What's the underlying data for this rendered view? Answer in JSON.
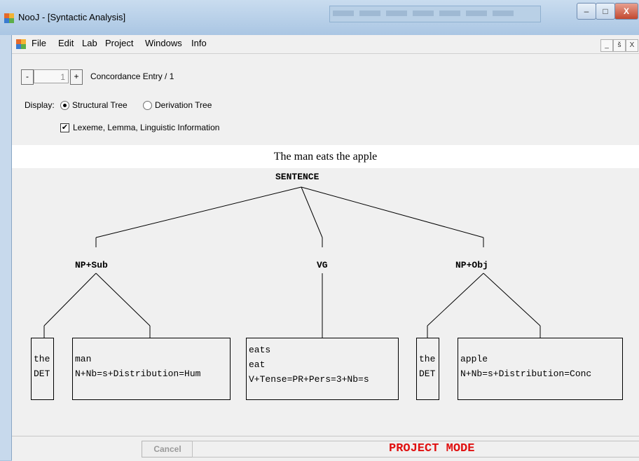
{
  "window": {
    "title": "NooJ - [Syntactic Analysis]",
    "min_label": "–",
    "max_label": "□",
    "close_label": "X"
  },
  "menu": {
    "items": [
      "File",
      "Edit",
      "Lab",
      "Project",
      "Windows",
      "Info"
    ],
    "mdi_min": "_",
    "mdi_restore": "š",
    "mdi_close": "X"
  },
  "controls": {
    "prev_label": "-",
    "entry_value": "1",
    "next_label": "+",
    "concordance_label": "Concordance Entry / 1",
    "display_label": "Display:",
    "structural_tree_label": "Structural Tree",
    "structural_tree_selected": true,
    "derivation_tree_label": "Derivation Tree",
    "derivation_tree_selected": false,
    "lexeme_checkbox_label": "Lexeme, Lemma, Linguistic Information",
    "lexeme_checked": true
  },
  "sentence": "The man eats the apple",
  "tree": {
    "root": "SENTENCE",
    "phrases": [
      "NP+Sub",
      "VG",
      "NP+Obj"
    ],
    "leaves": [
      {
        "lines": [
          "the",
          "DET"
        ]
      },
      {
        "lines": [
          "man",
          "N+Nb=s+Distribution=Hum"
        ]
      },
      {
        "lines": [
          "eats",
          "eat",
          "V+Tense=PR+Pers=3+Nb=s"
        ]
      },
      {
        "lines": [
          "the",
          "DET"
        ]
      },
      {
        "lines": [
          "apple",
          "N+Nb=s+Distribution=Conc"
        ]
      }
    ]
  },
  "status": {
    "cancel_label": "Cancel",
    "mode_label": "PROJECT MODE"
  },
  "colors": {
    "mode_text": "#e01010",
    "title_bar": "#aac6e3"
  }
}
